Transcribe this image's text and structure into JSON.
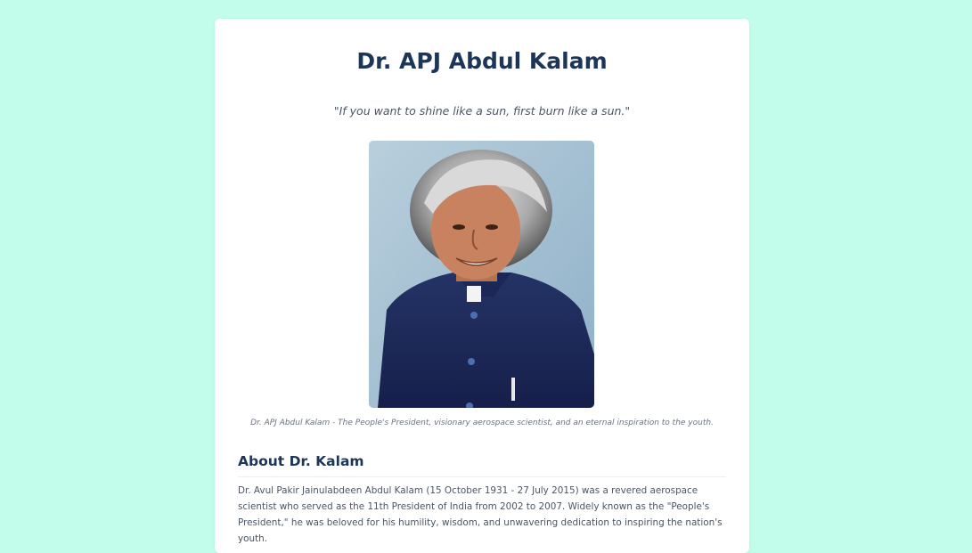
{
  "page": {
    "background_color": "#c2fdeb",
    "title": "Dr. APJ Abdul Kalam",
    "quote": "\"If you want to shine like a sun, first burn like a sun.\"",
    "caption": "Dr. APJ Abdul Kalam - The People's President, visionary aerospace scientist, and an eternal inspiration to the youth.",
    "accent_color": "#1d3557"
  },
  "about": {
    "heading": "About Dr. Kalam",
    "paragraph": "Dr. Avul Pakir Jainulabdeen Abdul Kalam (15 October 1931 - 27 July 2015) was a revered aerospace scientist who served as the 11th President of India from 2002 to 2007. Widely known as the \"People's President,\" he was beloved for his humility, wisdom, and unwavering dedication to inspiring the nation's youth."
  }
}
